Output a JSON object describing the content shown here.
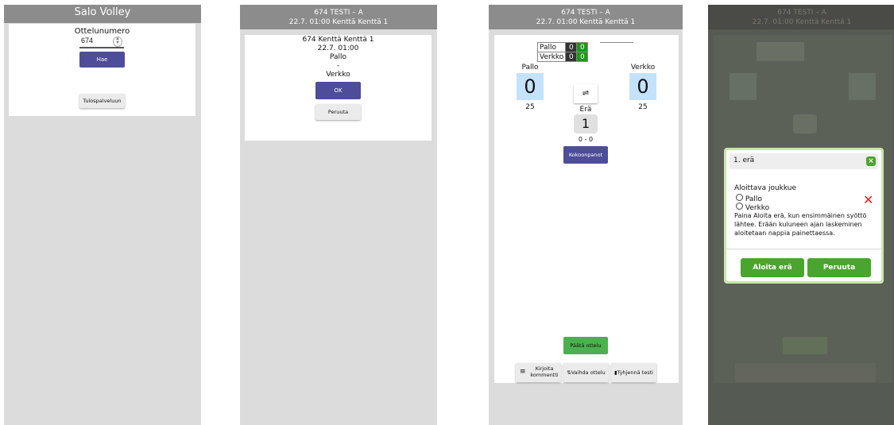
{
  "screen1": {
    "header_title": "Salo Volley",
    "match_number_label": "Ottelunumero",
    "match_number_value": "674",
    "search_button": "Hae",
    "results_button": "Tulospalveluun"
  },
  "screen2": {
    "header_line1": "674 TESTI – A",
    "header_line2": "22.7. 01:00 Kenttä Kenttä 1",
    "match_title": "674 Kenttä Kenttä 1",
    "match_time": "22.7. 01:00",
    "home_team": "Pallo",
    "separator": "-",
    "away_team": "Verkko",
    "ok_button": "OK",
    "cancel_button": "Peruuta"
  },
  "screen3": {
    "header_line1": "674 TESTI – A",
    "header_line2": "22.7. 01:00 Kenttä Kenttä 1",
    "mini_table": [
      {
        "team": "Pallo",
        "sets": "0",
        "points": "0"
      },
      {
        "team": "Verkko",
        "sets": "0",
        "points": "0"
      }
    ],
    "home_label": "Pallo",
    "away_label": "Verkko",
    "home_score": "0",
    "away_score": "0",
    "home_target": "25",
    "away_target": "25",
    "set_label": "Erä",
    "set_number": "1",
    "set_score": "0 - 0",
    "lineups_button": "Kokoonpanot",
    "end_match_button": "Päätä ottelu",
    "comment_button": "Kirjoita kommentti",
    "switch_button": "Vaihda ottelu",
    "clear_button": "Tyhjennä testi",
    "colors": {
      "score_bg": "#c4e2fb",
      "green": "#4caf50",
      "dark_cell": "#333333",
      "green_cell": "#169b16"
    }
  },
  "screen4": {
    "header_line1": "674 TESTI – A",
    "header_line2": "22.7. 01:00 Kenttä Kenttä 1",
    "dialog": {
      "title": "1. erä",
      "section_label": "Aloittava joukkue",
      "options": [
        "Pallo",
        "Verkko"
      ],
      "info_text": "Paina Aloita erä, kun ensimmäinen syöttö lähtee. Erään kuluneen ajan laskeminen aloitetaan nappia painettaessa.",
      "start_button": "Aloita erä",
      "cancel_button": "Peruuta",
      "colors": {
        "button_green": "#4aa52e",
        "border": "#c8e6a8",
        "close_x": "#e02020"
      }
    }
  }
}
